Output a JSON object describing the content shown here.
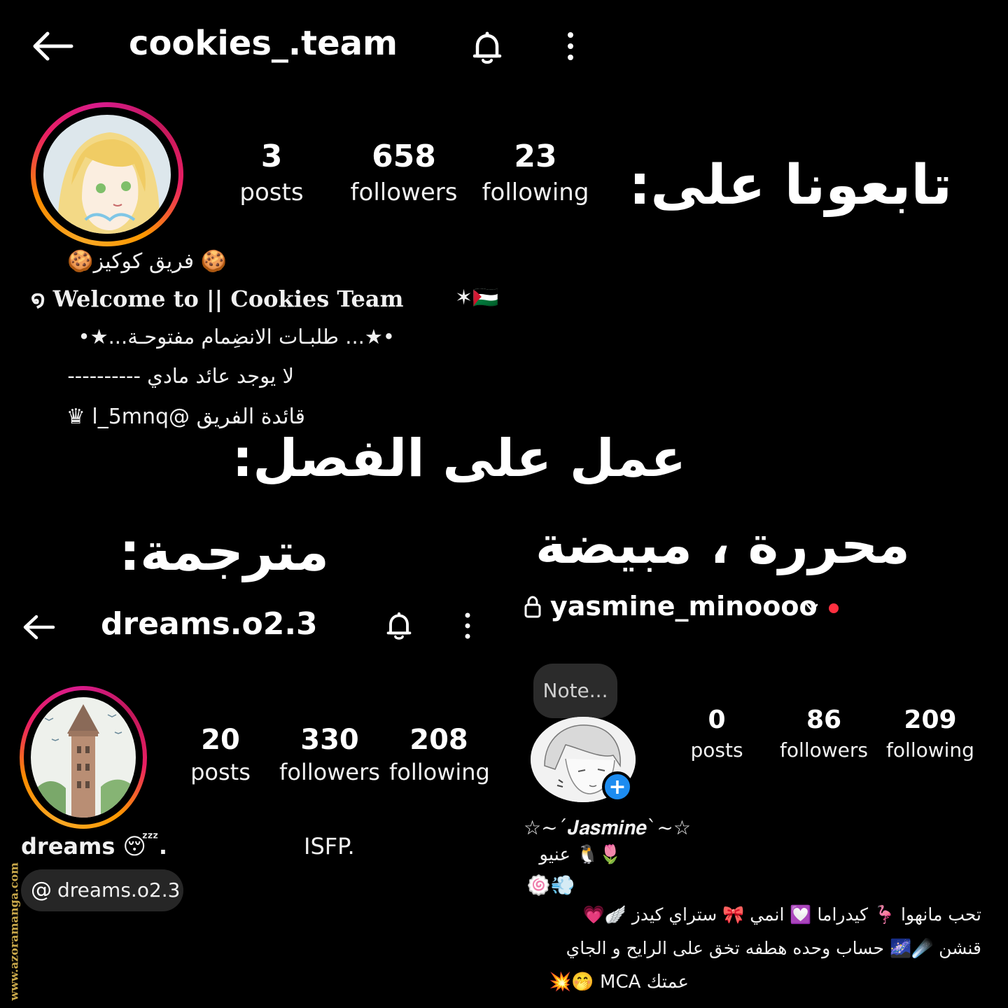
{
  "profile1": {
    "username": "cookies_.team",
    "posts_count": "3",
    "posts_label": "posts",
    "followers_count": "658",
    "followers_label": "followers",
    "following_count": "23",
    "following_label": "following",
    "bio_name": "🍪 فريق كوكيز🍪",
    "bio_welcome": "໑ Welcome to || Cookies Team",
    "bio_flag": "✶🇵🇸",
    "bio_line3": "•★... طلبـات الانضِمام مفتوحـة...★•",
    "bio_line4": "لا يوجد عائد مادي ----------",
    "bio_line5": "♛ l_5mnq@ قائدة الفريق"
  },
  "headings": {
    "follow_us": "تابعونا على:",
    "worked_on": "عمل على الفصل:",
    "translator": "مترجمة:",
    "editor": "محررة ، مبيضة"
  },
  "profile2": {
    "username": "dreams.o2.3",
    "posts_count": "20",
    "posts_label": "posts",
    "followers_count": "330",
    "followers_label": "followers",
    "following_count": "208",
    "following_label": "following",
    "bio_name": "dreams 😴.",
    "bio_mbti": "ISFP.",
    "threads_handle": "dreams.o2.3"
  },
  "profile3": {
    "username": "yasmine_minoooo",
    "note_label": "Note...",
    "posts_count": "0",
    "posts_label": "posts",
    "followers_count": "86",
    "followers_label": "followers",
    "following_count": "209",
    "following_label": "following",
    "bio_name": "☆~´𝑱𝒂𝒔𝒎𝒊𝒏𝒆`~☆",
    "bio_line2": "🌷🐧 عنيو",
    "bio_line3": "🍥💨",
    "bio_line4": "تحب مانهوا 🦩 كيدراما 💟 انمي 🎀 ستراي كيدز 🪽💗",
    "bio_line5": "قنشن ☄️🌌 حساب وحده هطفه تخق على الرايح و الجاي",
    "bio_line6": "💥🤭 MCA عمتك"
  },
  "watermark": "www.azoramanga.com",
  "colors": {
    "background": "#000000",
    "add_badge": "#1d8cf0",
    "status_dot": "#ff3040"
  }
}
